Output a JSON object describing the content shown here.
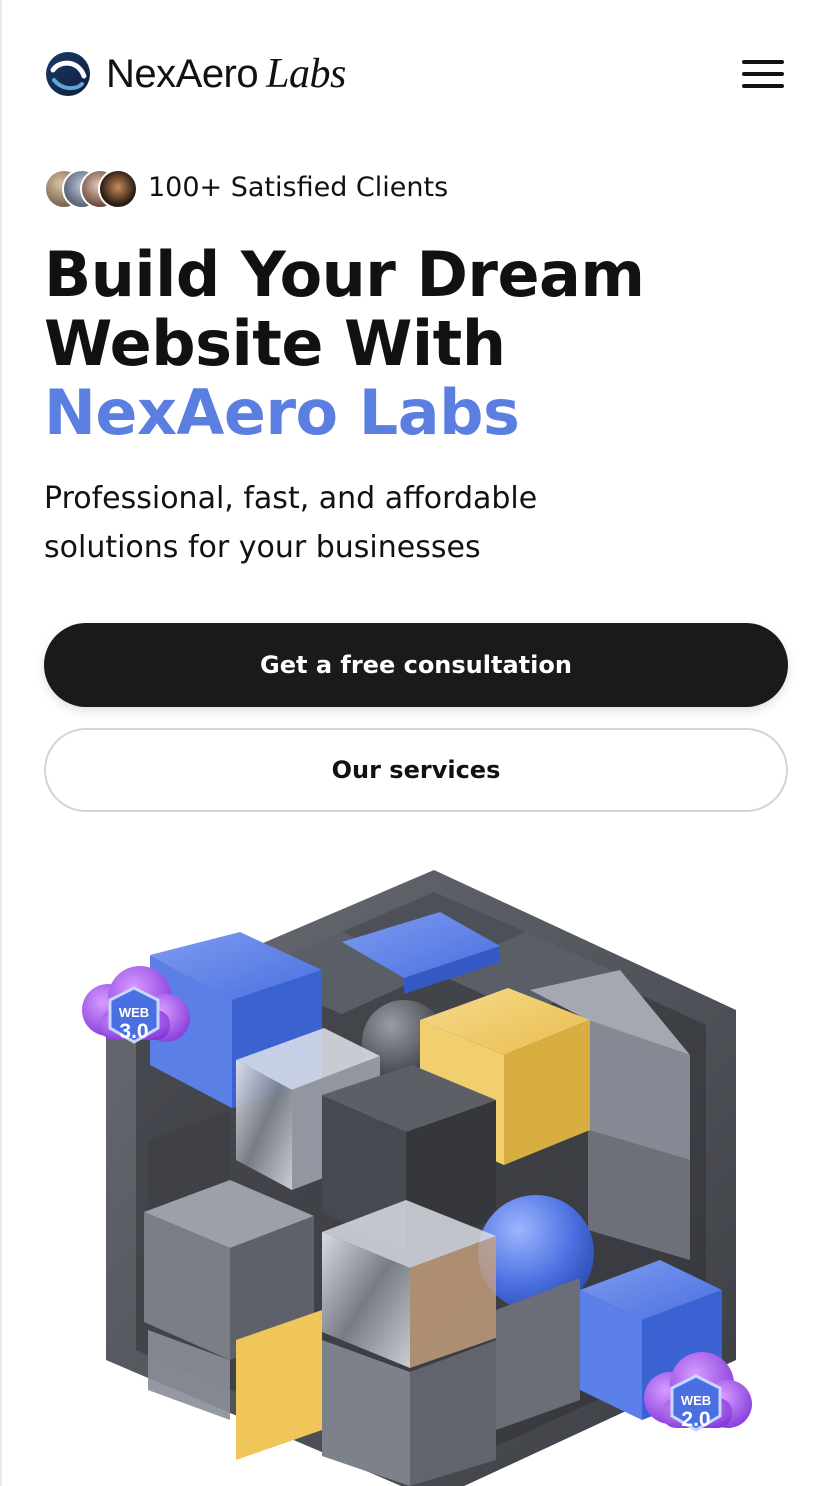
{
  "header": {
    "brand_name": "NexAero",
    "brand_suffix": "Labs",
    "logo_icon": "nexaero-logo-mark",
    "menu_icon": "hamburger-menu-icon"
  },
  "clients": {
    "text": "100+ Satisfied Clients",
    "avatar_count": 4
  },
  "hero": {
    "headline_line1": "Build Your Dream",
    "headline_line2": "Website With",
    "headline_accent": "NexAero Labs",
    "subtitle_line1": "Professional, fast, and affordable",
    "subtitle_line2": "solutions for your businesses"
  },
  "buttons": {
    "primary_label": "Get a free consultation",
    "secondary_label": "Our services"
  },
  "illustration": {
    "badge_top_label": "WEB",
    "badge_top_version": "3.0",
    "badge_bottom_label": "WEB",
    "badge_bottom_version": "2.0"
  },
  "colors": {
    "accent": "#5b7fe0",
    "primary_button": "#1a1a1c",
    "cube_blue": "#4f78e0",
    "cube_yellow": "#f0c65a",
    "cube_gray": "#7b7f88",
    "badge_purple": "#8a3fe0"
  }
}
